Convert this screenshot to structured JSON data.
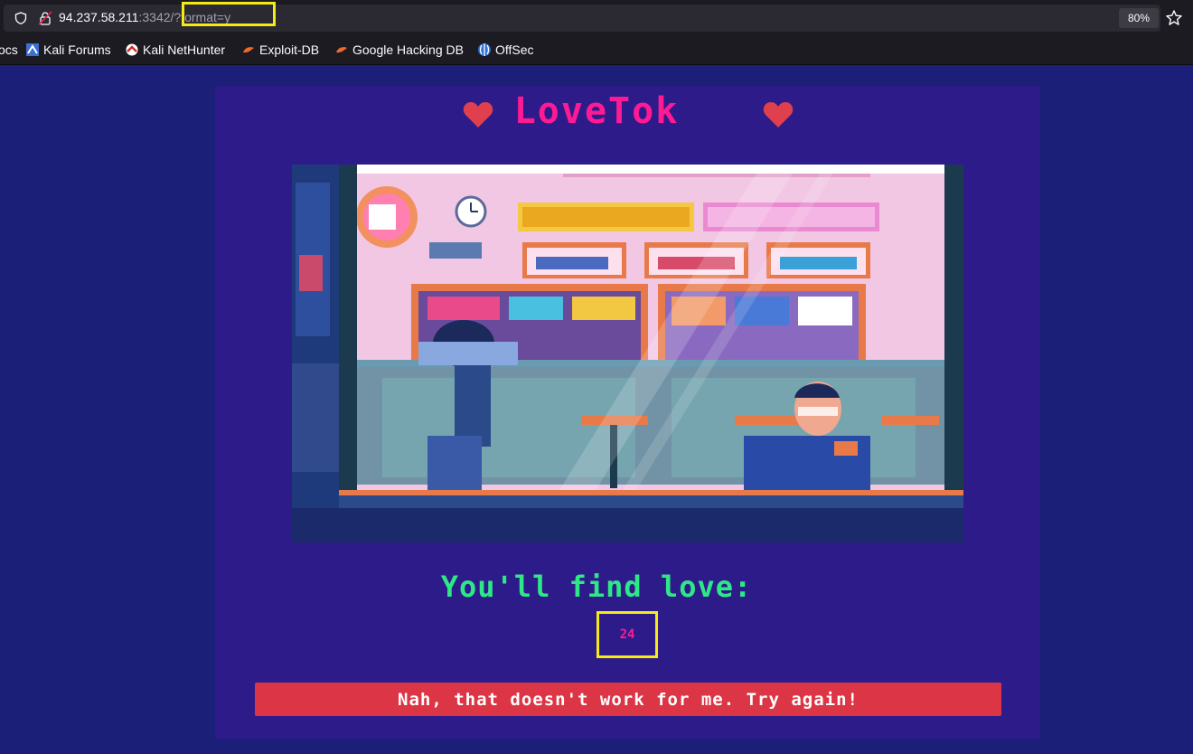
{
  "browser": {
    "url_host": "94.237.58.211",
    "url_port": ":3342",
    "url_path": "/?format=y",
    "zoom": "80%"
  },
  "bookmarks": [
    {
      "label": "ocs",
      "icon": "docs-icon"
    },
    {
      "label": "Kali Forums",
      "icon": "kali-forums-icon"
    },
    {
      "label": "Kali NetHunter",
      "icon": "kali-nethunter-icon"
    },
    {
      "label": "Exploit-DB",
      "icon": "exploit-db-icon"
    },
    {
      "label": "Google Hacking DB",
      "icon": "ghdb-icon"
    },
    {
      "label": "OffSec",
      "icon": "offsec-icon"
    }
  ],
  "page": {
    "title": "LoveTok",
    "subtitle": "You'll find love:",
    "result": "24",
    "button_label": "Nah, that doesn't work for me. Try again!"
  },
  "colors": {
    "background": "#1b1f78",
    "card": "#2e1b8a",
    "title": "#ff1a94",
    "subtitle": "#2ee887",
    "button": "#dc3545",
    "highlight": "#f5ea14",
    "heart": "#e0404e"
  }
}
